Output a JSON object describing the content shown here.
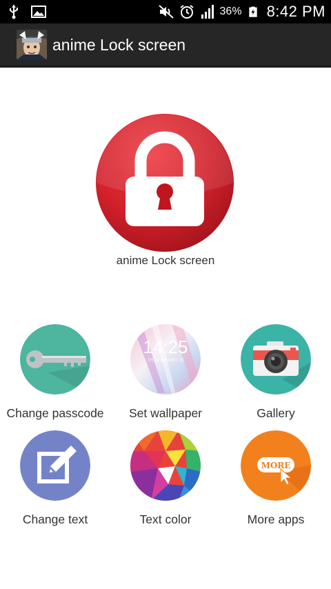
{
  "status_bar": {
    "battery_percent": "36%",
    "time": "8:42 PM",
    "icons": [
      "usb-icon",
      "image-icon",
      "mute-icon",
      "alarm-icon",
      "signal-icon",
      "battery-icon"
    ]
  },
  "action_bar": {
    "app_icon": "anime-avatar-icon",
    "title": "anime Lock screen"
  },
  "hero": {
    "icon": "padlock-icon",
    "caption": "anime Lock screen",
    "color": "#d0202a"
  },
  "grid": {
    "items": [
      {
        "label": "Change passcode",
        "icon": "key-icon",
        "color": "#4eb59e"
      },
      {
        "label": "Set wallpaper",
        "icon": "wallpaper-preview-icon",
        "color": "#e9e1f0",
        "preview_time": "14:25",
        "preview_date": "TH, FEBRUARY 15"
      },
      {
        "label": "Gallery",
        "icon": "camera-icon",
        "color": "#3cb3a7"
      },
      {
        "label": "Change text",
        "icon": "edit-text-icon",
        "color": "#7483c7"
      },
      {
        "label": "Text color",
        "icon": "color-palette-icon",
        "color": "#e8433b"
      },
      {
        "label": "More apps",
        "icon": "more-icon",
        "color": "#f2811d",
        "badge_text": "MORE"
      }
    ]
  }
}
